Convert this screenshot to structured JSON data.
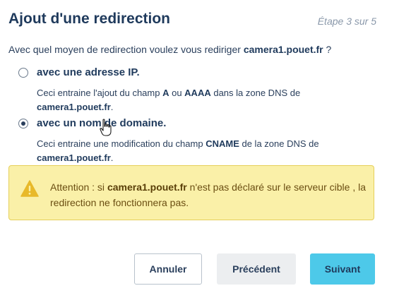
{
  "header": {
    "title": "Ajout d'une redirection",
    "step": "Étape 3 sur 5"
  },
  "question": {
    "prefix": "Avec quel moyen de redirection voulez vous rediriger ",
    "domain": "camera1.pouet.fr",
    "suffix": " ?"
  },
  "options": [
    {
      "label": "avec une adresse IP.",
      "selected": false,
      "desc_part1": "Ceci entraine l'ajout du champ ",
      "desc_bold1": "A",
      "desc_part2": " ou ",
      "desc_bold2": "AAAA",
      "desc_part3": " dans la zone DNS de",
      "desc_domain": "camera1.pouet.fr",
      "desc_end": "."
    },
    {
      "label": "avec un nom de domaine.",
      "selected": true,
      "desc_part1": "Ceci entraine une modification du champ ",
      "desc_bold1": "CNAME",
      "desc_part2": " de la zone DNS de",
      "desc_domain": "camera1.pouet.fr",
      "desc_end": "."
    }
  ],
  "alert": {
    "prefix": "Attention : si ",
    "domain": "camera1.pouet.fr",
    "suffix": " n'est pas déclaré sur le serveur cible , la redirection ne fonctionnera pas.",
    "icon": "warning-icon",
    "background": "#faf0a8",
    "icon_color": "#e8b92a"
  },
  "buttons": {
    "cancel": "Annuler",
    "previous": "Précédent",
    "next": "Suivant",
    "next_color": "#4dc9e9"
  }
}
